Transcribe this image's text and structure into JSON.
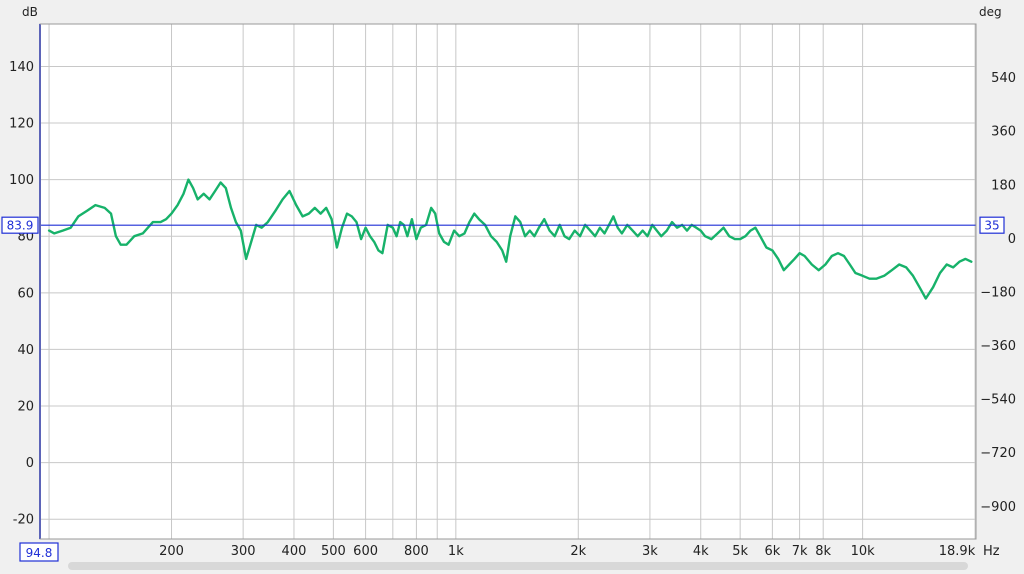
{
  "chart_data": {
    "type": "line",
    "xscale": "log",
    "xlim": [
      95,
      19000
    ],
    "ylim": [
      -27,
      155
    ],
    "ylim_right": [
      -1010,
      720
    ],
    "grid": true,
    "ylabel": "dB",
    "ylabel_right": "deg",
    "xunit": "Hz",
    "x_ticks": [
      {
        "value": 200,
        "label": "200"
      },
      {
        "value": 300,
        "label": "300"
      },
      {
        "value": 400,
        "label": "400"
      },
      {
        "value": 500,
        "label": "500"
      },
      {
        "value": 600,
        "label": "600"
      },
      {
        "value": 800,
        "label": "800"
      },
      {
        "value": 1000,
        "label": "1k"
      },
      {
        "value": 2000,
        "label": "2k"
      },
      {
        "value": 3000,
        "label": "3k"
      },
      {
        "value": 4000,
        "label": "4k"
      },
      {
        "value": 5000,
        "label": "5k"
      },
      {
        "value": 6000,
        "label": "6k"
      },
      {
        "value": 7000,
        "label": "7k"
      },
      {
        "value": 8000,
        "label": "8k"
      },
      {
        "value": 10000,
        "label": "10k"
      }
    ],
    "x_minor": [
      700,
      900
    ],
    "x_end_label": "18.9k",
    "x_start_label": "94.8",
    "y_ticks": [
      {
        "value": 140,
        "label": "140"
      },
      {
        "value": 120,
        "label": "120"
      },
      {
        "value": 100,
        "label": "100"
      },
      {
        "value": 80,
        "label": "80"
      },
      {
        "value": 60,
        "label": "60"
      },
      {
        "value": 40,
        "label": "40"
      },
      {
        "value": 20,
        "label": "20"
      },
      {
        "value": 0,
        "label": "0"
      },
      {
        "value": -20,
        "label": "-20"
      }
    ],
    "y_ticks_right": [
      {
        "value": 540,
        "label": "540"
      },
      {
        "value": 360,
        "label": "360"
      },
      {
        "value": 180,
        "label": "180"
      },
      {
        "value": 0,
        "label": "0"
      },
      {
        "value": -180,
        "label": "-180"
      },
      {
        "value": -360,
        "label": "-360"
      },
      {
        "value": -540,
        "label": "-540"
      },
      {
        "value": -720,
        "label": "-720"
      },
      {
        "value": -900,
        "label": "-900"
      }
    ],
    "cursor": {
      "db": 83.9,
      "db_label": "83.9",
      "deg_label": "35"
    },
    "colors": {
      "series": "#17b26a",
      "cursor": "#1f2fd6",
      "grid": "#c8c8c8"
    },
    "series": [
      {
        "points": [
          [
            100,
            82
          ],
          [
            103,
            81
          ],
          [
            108,
            82
          ],
          [
            113,
            83
          ],
          [
            118,
            87
          ],
          [
            124,
            89
          ],
          [
            130,
            91
          ],
          [
            137,
            90
          ],
          [
            142,
            88
          ],
          [
            146,
            80
          ],
          [
            150,
            77
          ],
          [
            155,
            77
          ],
          [
            162,
            80
          ],
          [
            170,
            81
          ],
          [
            180,
            85
          ],
          [
            188,
            85
          ],
          [
            194,
            86
          ],
          [
            200,
            88
          ],
          [
            207,
            91
          ],
          [
            214,
            95
          ],
          [
            220,
            100
          ],
          [
            226,
            97
          ],
          [
            232,
            93
          ],
          [
            240,
            95
          ],
          [
            248,
            93
          ],
          [
            256,
            96
          ],
          [
            264,
            99
          ],
          [
            272,
            97
          ],
          [
            280,
            90
          ],
          [
            288,
            85
          ],
          [
            296,
            82
          ],
          [
            305,
            72
          ],
          [
            314,
            78
          ],
          [
            323,
            84
          ],
          [
            333,
            83
          ],
          [
            345,
            85
          ],
          [
            360,
            89
          ],
          [
            375,
            93
          ],
          [
            390,
            96
          ],
          [
            405,
            91
          ],
          [
            420,
            87
          ],
          [
            435,
            88
          ],
          [
            450,
            90
          ],
          [
            465,
            88
          ],
          [
            480,
            90
          ],
          [
            495,
            86
          ],
          [
            510,
            76
          ],
          [
            525,
            83
          ],
          [
            540,
            88
          ],
          [
            555,
            87
          ],
          [
            570,
            85
          ],
          [
            585,
            79
          ],
          [
            600,
            83
          ],
          [
            615,
            80
          ],
          [
            630,
            78
          ],
          [
            645,
            75
          ],
          [
            660,
            74
          ],
          [
            680,
            84
          ],
          [
            700,
            83
          ],
          [
            715,
            80
          ],
          [
            730,
            85
          ],
          [
            745,
            84
          ],
          [
            760,
            80
          ],
          [
            780,
            86
          ],
          [
            800,
            79
          ],
          [
            820,
            83
          ],
          [
            845,
            84
          ],
          [
            870,
            90
          ],
          [
            890,
            88
          ],
          [
            910,
            81
          ],
          [
            935,
            78
          ],
          [
            960,
            77
          ],
          [
            990,
            82
          ],
          [
            1020,
            80
          ],
          [
            1050,
            81
          ],
          [
            1080,
            85
          ],
          [
            1110,
            88
          ],
          [
            1140,
            86
          ],
          [
            1180,
            84
          ],
          [
            1220,
            80
          ],
          [
            1260,
            78
          ],
          [
            1300,
            75
          ],
          [
            1330,
            71
          ],
          [
            1360,
            80
          ],
          [
            1400,
            87
          ],
          [
            1440,
            85
          ],
          [
            1480,
            80
          ],
          [
            1520,
            82
          ],
          [
            1560,
            80
          ],
          [
            1600,
            83
          ],
          [
            1650,
            86
          ],
          [
            1700,
            82
          ],
          [
            1750,
            80
          ],
          [
            1800,
            84
          ],
          [
            1850,
            80
          ],
          [
            1900,
            79
          ],
          [
            1960,
            82
          ],
          [
            2020,
            80
          ],
          [
            2080,
            84
          ],
          [
            2140,
            82
          ],
          [
            2200,
            80
          ],
          [
            2260,
            83
          ],
          [
            2320,
            81
          ],
          [
            2380,
            84
          ],
          [
            2440,
            87
          ],
          [
            2500,
            83
          ],
          [
            2560,
            81
          ],
          [
            2640,
            84
          ],
          [
            2720,
            82
          ],
          [
            2800,
            80
          ],
          [
            2880,
            82
          ],
          [
            2960,
            80
          ],
          [
            3040,
            84
          ],
          [
            3120,
            82
          ],
          [
            3200,
            80
          ],
          [
            3300,
            82
          ],
          [
            3400,
            85
          ],
          [
            3500,
            83
          ],
          [
            3600,
            84
          ],
          [
            3700,
            82
          ],
          [
            3800,
            84
          ],
          [
            3900,
            83
          ],
          [
            4000,
            82
          ],
          [
            4100,
            80
          ],
          [
            4250,
            79
          ],
          [
            4400,
            81
          ],
          [
            4550,
            83
          ],
          [
            4700,
            80
          ],
          [
            4850,
            79
          ],
          [
            5000,
            79
          ],
          [
            5150,
            80
          ],
          [
            5300,
            82
          ],
          [
            5450,
            83
          ],
          [
            5600,
            80
          ],
          [
            5800,
            76
          ],
          [
            6000,
            75
          ],
          [
            6200,
            72
          ],
          [
            6400,
            68
          ],
          [
            6600,
            70
          ],
          [
            6800,
            72
          ],
          [
            7000,
            74
          ],
          [
            7200,
            73
          ],
          [
            7500,
            70
          ],
          [
            7800,
            68
          ],
          [
            8100,
            70
          ],
          [
            8400,
            73
          ],
          [
            8700,
            74
          ],
          [
            9000,
            73
          ],
          [
            9300,
            70
          ],
          [
            9600,
            67
          ],
          [
            10000,
            66
          ],
          [
            10400,
            65
          ],
          [
            10800,
            65
          ],
          [
            11300,
            66
          ],
          [
            11800,
            68
          ],
          [
            12300,
            70
          ],
          [
            12800,
            69
          ],
          [
            13300,
            66
          ],
          [
            13800,
            62
          ],
          [
            14300,
            58
          ],
          [
            14900,
            62
          ],
          [
            15500,
            67
          ],
          [
            16100,
            70
          ],
          [
            16700,
            69
          ],
          [
            17300,
            71
          ],
          [
            17900,
            72
          ],
          [
            18500,
            71
          ]
        ]
      }
    ]
  }
}
